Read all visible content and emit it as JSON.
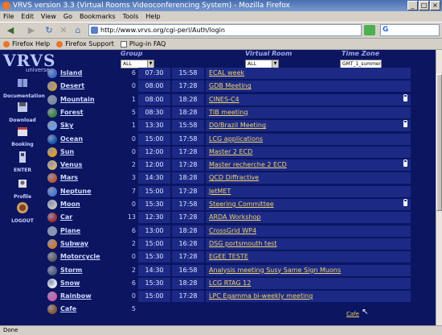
{
  "window": {
    "title": "VRVS version 3.3 (Virtual Rooms Videoconferencing System) - Mozilla Firefox"
  },
  "menu": [
    "File",
    "Edit",
    "View",
    "Go",
    "Bookmarks",
    "Tools",
    "Help"
  ],
  "nav": {
    "url": "http://www.vrvs.org/cgi-perl/Auth/login"
  },
  "bookmarks": [
    "Firefox Help",
    "Firefox Support",
    "Plug-in FAQ"
  ],
  "header": {
    "logo": "VRVS",
    "logo_sub": "universe",
    "filters": [
      {
        "label": "Group",
        "value": "ALL"
      },
      {
        "label": "Virtual Room",
        "value": "ALL"
      },
      {
        "label": "Time Zone",
        "value": "GMT_1_summer"
      }
    ]
  },
  "left_nav": [
    {
      "label": "Documentation",
      "icon": "book-icon"
    },
    {
      "label": "Download",
      "icon": "disk-icon"
    },
    {
      "label": "Booking",
      "icon": "calendar-icon"
    },
    {
      "label": "ENTER",
      "icon": "enter-icon"
    },
    {
      "label": "Profile",
      "icon": "profile-icon"
    },
    {
      "label": "LOGOUT",
      "icon": "logout-icon"
    }
  ],
  "rooms": [
    {
      "name": "Island",
      "count": "6",
      "start": "07:30",
      "end": "15:58",
      "title": "ECAL week",
      "color": "#3a6ad0",
      "lock": false
    },
    {
      "name": "Desert",
      "count": "0",
      "start": "08:00",
      "end": "17:28",
      "title": "GDB Meeting",
      "color": "#c89a4a",
      "lock": false
    },
    {
      "name": "Mountain",
      "count": "1",
      "start": "08:00",
      "end": "18:28",
      "title": "CINES-C4",
      "color": "#7a8aa0",
      "lock": true
    },
    {
      "name": "Forest",
      "count": "5",
      "start": "08:30",
      "end": "18:28",
      "title": "TIB meeting",
      "color": "#3a8a3a",
      "lock": false
    },
    {
      "name": "Sky",
      "count": "1",
      "start": "13:30",
      "end": "15:58",
      "title": "D0/Brazil Meeting",
      "color": "#6aa0e0",
      "lock": true
    },
    {
      "name": "Ocean",
      "count": "0",
      "start": "15:00",
      "end": "17:58",
      "title": "LCG applications",
      "color": "#1a5ab0",
      "lock": false
    },
    {
      "name": "Sun",
      "count": "0",
      "start": "12:00",
      "end": "17:28",
      "title": "Master 2 ECD",
      "color": "#e0a020",
      "lock": false
    },
    {
      "name": "Venus",
      "count": "2",
      "start": "12:00",
      "end": "17:28",
      "title": "Master recherche 2 ECD",
      "color": "#d0b070",
      "lock": true
    },
    {
      "name": "Mars",
      "count": "3",
      "start": "14:30",
      "end": "18:28",
      "title": "QCD Diffractive",
      "color": "#c05a30",
      "lock": false
    },
    {
      "name": "Neptune",
      "count": "7",
      "start": "15:00",
      "end": "17:28",
      "title": "JetMET",
      "color": "#4a7ad0",
      "lock": false
    },
    {
      "name": "Moon",
      "count": "0",
      "start": "15:30",
      "end": "17:58",
      "title": "Steering Committee",
      "color": "#c0c0c0",
      "lock": true
    },
    {
      "name": "Car",
      "count": "13",
      "start": "12:30",
      "end": "17:28",
      "title": "ARDA Workshop",
      "color": "#a03030",
      "lock": false
    },
    {
      "name": "Plane",
      "count": "6",
      "start": "13:00",
      "end": "18:28",
      "title": "CrossGrid WP4",
      "color": "#8a9ab0",
      "lock": false
    },
    {
      "name": "Subway",
      "count": "2",
      "start": "15:00",
      "end": "16:28",
      "title": "DSG portsmouth test",
      "color": "#d07a30",
      "lock": false
    },
    {
      "name": "Motorcycle",
      "count": "0",
      "start": "15:30",
      "end": "17:28",
      "title": "EGEE TESTE",
      "color": "#606060",
      "lock": false
    },
    {
      "name": "Storm",
      "count": "2",
      "start": "14:30",
      "end": "16:58",
      "title": "Analysis meeting Susy Same Sign Muons",
      "color": "#506080",
      "lock": false
    },
    {
      "name": "Snow",
      "count": "6",
      "start": "15:30",
      "end": "18:28",
      "title": "LCG RTAG 12",
      "color": "#e0e8f0",
      "lock": false
    },
    {
      "name": "Rainbow",
      "count": "0",
      "start": "15:00",
      "end": "17:28",
      "title": "LPC Egamma bi-weekly meeting",
      "color": "#d05ab0",
      "lock": false
    },
    {
      "name": "Cafe",
      "count": "5",
      "start": "",
      "end": "",
      "title": "",
      "color": "#8a5a2a",
      "lock": false
    }
  ],
  "cafe_link": "Cafe",
  "status": "Done"
}
